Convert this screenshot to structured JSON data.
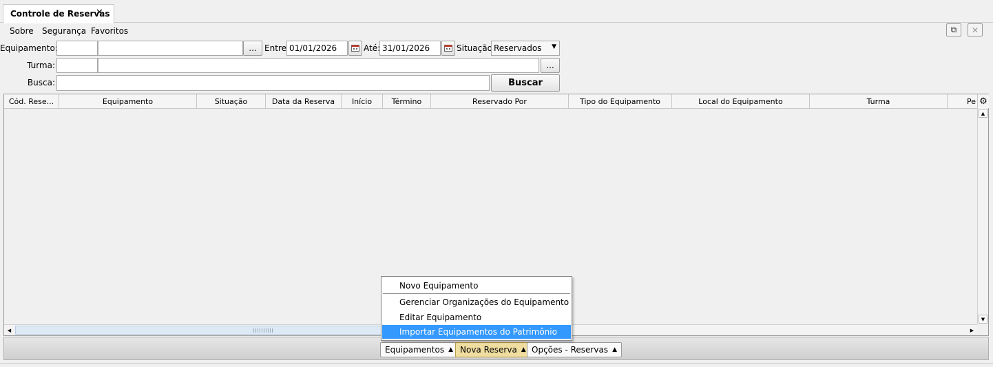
{
  "tab": {
    "title": "Controle de Reservas",
    "close": "✕"
  },
  "menu": {
    "sobre": "Sobre",
    "seguranca": "Segurança",
    "favoritos": "Favoritos"
  },
  "window_buttons": {
    "popout": "⧉",
    "close": "✕"
  },
  "filters": {
    "equipamento_label": "Equipamento:",
    "equipamento_code": "",
    "equipamento_name": "",
    "browse": "...",
    "entre_label": "Entre:",
    "entre_value": "01/01/2026",
    "ate_label": "Até:",
    "ate_value": "31/01/2026",
    "situacao_label": "Situação:",
    "situacao_value": "Reservados",
    "turma_label": "Turma:",
    "turma_code": "",
    "turma_name": "",
    "busca_label": "Busca:",
    "busca_value": "",
    "buscar_button": "Buscar"
  },
  "table": {
    "columns": [
      "Cód. Rese...",
      "Equipamento",
      "Situação",
      "Data da Reserva",
      "Início",
      "Término",
      "Reservado Por",
      "Tipo do Equipamento",
      "Local do Equipamento",
      "Turma",
      "Pe"
    ],
    "rows": []
  },
  "popup_menu": {
    "items": [
      "Novo Equipamento",
      "Gerenciar Organizações do Equipamento",
      "Editar Equipamento",
      "Importar Equipamentos do Patrimônio"
    ],
    "selected_index": 3
  },
  "bottom_buttons": {
    "equipamentos": "Equipamentos",
    "nova_reserva": "Nova Reserva",
    "opcoes": "Opções - Reservas"
  }
}
